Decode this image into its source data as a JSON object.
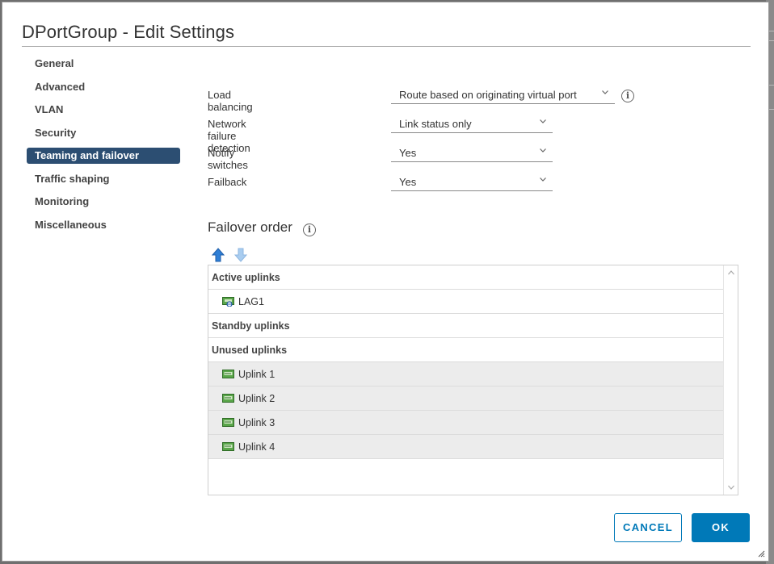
{
  "dialog": {
    "title": "DPortGroup - Edit Settings"
  },
  "nav": {
    "items": [
      {
        "label": "General"
      },
      {
        "label": "Advanced"
      },
      {
        "label": "VLAN"
      },
      {
        "label": "Security"
      },
      {
        "label": "Teaming and failover",
        "active": true
      },
      {
        "label": "Traffic shaping"
      },
      {
        "label": "Monitoring"
      },
      {
        "label": "Miscellaneous"
      }
    ]
  },
  "form": {
    "load_balancing": {
      "label": "Load balancing",
      "value": "Route based on originating virtual port"
    },
    "network_failure_detection": {
      "label": "Network failure detection",
      "value": "Link status only"
    },
    "notify_switches": {
      "label": "Notify switches",
      "value": "Yes"
    },
    "failback": {
      "label": "Failback",
      "value": "Yes"
    }
  },
  "failover": {
    "title": "Failover order",
    "groups": {
      "active": "Active uplinks",
      "standby": "Standby uplinks",
      "unused": "Unused uplinks"
    },
    "active_items": [
      "LAG1"
    ],
    "unused_items": [
      "Uplink 1",
      "Uplink 2",
      "Uplink 3",
      "Uplink 4"
    ]
  },
  "buttons": {
    "cancel": "CANCEL",
    "ok": "OK"
  },
  "colors": {
    "nav_active": "#2c4e72",
    "primary": "#0079b8",
    "unused_row": "#ececec"
  }
}
